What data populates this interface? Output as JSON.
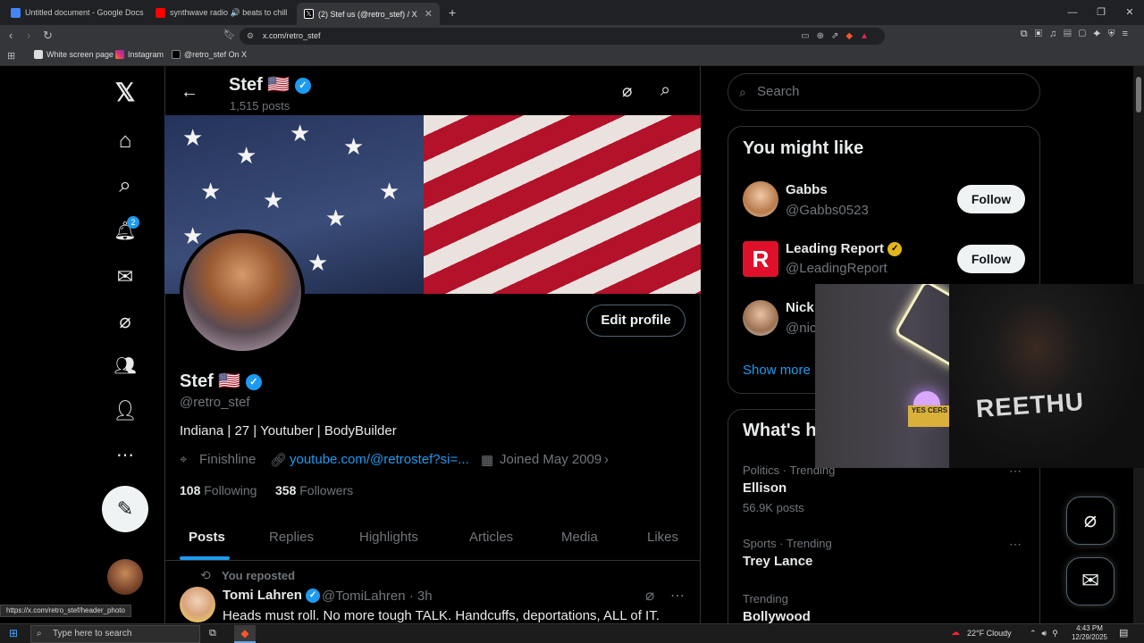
{
  "browser": {
    "tabs": [
      {
        "label": "Untitled document - Google Docs",
        "color": "#4285f4"
      },
      {
        "label": "synthwave radio 🔊 beats to chill",
        "color": "#ff0000"
      },
      {
        "label": "(2) Stef us (@retro_stef) / X",
        "color": "#ffffff"
      }
    ],
    "url": "x.com/retro_stef",
    "bookmarks": [
      "White screen page",
      "Instagram",
      "@retro_stef On X"
    ],
    "status_url": "https://x.com/retro_stef/header_photo"
  },
  "leftnav": {
    "notification_count": "2"
  },
  "profile": {
    "header_name": "Stef 🇺🇸",
    "post_count": "1,515 posts",
    "edit_profile": "Edit profile",
    "name": "Stef 🇺🇸",
    "handle": "@retro_stef",
    "bio": "Indiana | 27 | Youtuber | BodyBuilder",
    "location": "Finishline",
    "website": "youtube.com/@retrostef?si=...",
    "joined": "Joined May 2009",
    "following_count": "108",
    "following_label": "Following",
    "followers_count": "358",
    "followers_label": "Followers",
    "tabs": [
      "Posts",
      "Replies",
      "Highlights",
      "Articles",
      "Media",
      "Likes"
    ]
  },
  "post": {
    "reposted": "You reposted",
    "name": "Tomi Lahren",
    "handle_time": "@TomiLahren · 3h",
    "text": "Heads must roll. No more tough TALK. Handcuffs, deportations, ALL of IT."
  },
  "right": {
    "search_placeholder": "Search",
    "you_might_like": "You might like",
    "suggestions": [
      {
        "name": "Gabbs",
        "handle": "@Gabbs0523",
        "follow": "Follow"
      },
      {
        "name": "Leading Report",
        "handle": "@LeadingReport",
        "follow": "Follow"
      },
      {
        "name": "Nick",
        "handle": "@nic"
      }
    ],
    "show_more": "Show more",
    "whats_happening": "What's h",
    "trends": [
      {
        "category": "Politics · Trending",
        "title": "Ellison",
        "posts": "56.9K posts"
      },
      {
        "category": "Sports · Trending",
        "title": "Trey Lance",
        "posts": ""
      },
      {
        "category": "Trending",
        "title": "Bollywood",
        "posts": ""
      }
    ]
  },
  "webcam": {
    "sign_text": "YES CERS",
    "shirt_text": "REETHU"
  },
  "taskbar": {
    "search_placeholder": "Type here to search",
    "weather": "22°F  Cloudy",
    "time": "4:43 PM",
    "date": "12/29/2025"
  },
  "colors": {
    "accent": "#1d9bf0",
    "background": "#000000",
    "border": "#2f3336",
    "muted_text": "#71767b"
  }
}
